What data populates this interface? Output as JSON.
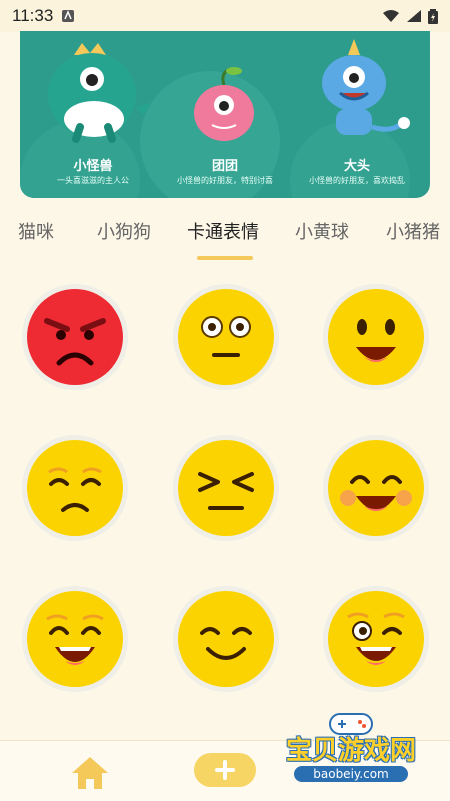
{
  "status_bar": {
    "time": "11:33"
  },
  "banner": {
    "characters": [
      {
        "name": "小怪兽",
        "desc": "一头喜滋滋的主人公"
      },
      {
        "name": "团团",
        "desc": "小怪兽的好朋友，特别讨喜"
      },
      {
        "name": "大头",
        "desc": "小怪兽的好朋友，喜欢捣乱"
      }
    ]
  },
  "tabs": [
    "猫咪",
    "小狗狗",
    "卡通表情",
    "小黄球",
    "小猪猪"
  ],
  "active_tab": "卡通表情",
  "colors": {
    "accent": "#f4c95a",
    "banner_bg": "#2d9c8d",
    "page_bg": "#fdf7e8",
    "face_yellow": "#fbd300",
    "face_red": "#ee2b33"
  },
  "emoji_grid": [
    {
      "name": "angry-face"
    },
    {
      "name": "neutral-face"
    },
    {
      "name": "happy-face"
    },
    {
      "name": "sad-face"
    },
    {
      "name": "squint-face"
    },
    {
      "name": "grin-face"
    },
    {
      "name": "laugh-face"
    },
    {
      "name": "smile-face"
    },
    {
      "name": "wink-face"
    }
  ],
  "bottom_nav": {
    "home_icon": "home-icon",
    "add_icon": "plus-icon"
  },
  "watermark": {
    "title": "宝贝游戏网",
    "url": "baobeiy.com"
  }
}
